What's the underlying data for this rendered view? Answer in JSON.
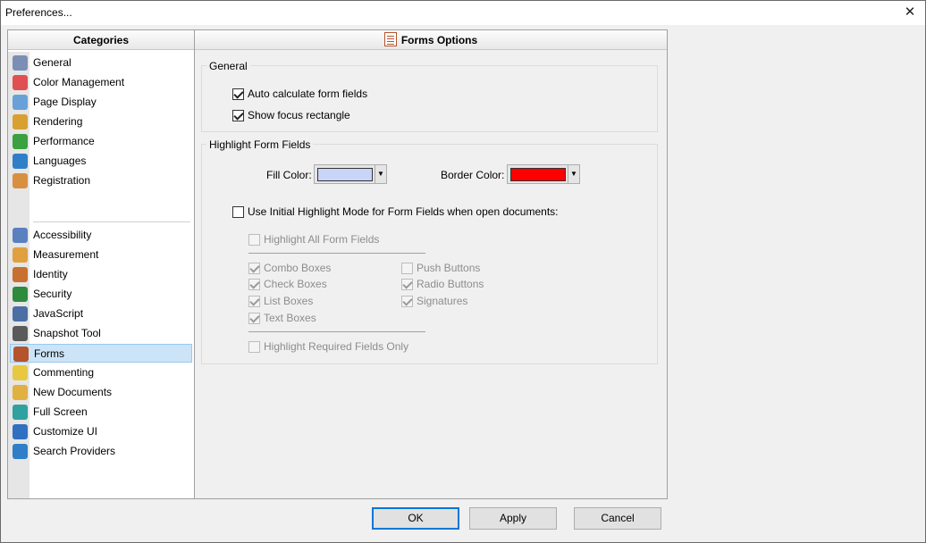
{
  "window": {
    "title": "Preferences...",
    "close_glyph": "✕"
  },
  "categories": {
    "header": "Categories",
    "group1": [
      {
        "label": "General",
        "icon": "gears-icon",
        "color": "#7b8fb5"
      },
      {
        "label": "Color Management",
        "icon": "color-circles-icon",
        "color": "#e05050"
      },
      {
        "label": "Page Display",
        "icon": "magnifier-page-icon",
        "color": "#6aa0d8"
      },
      {
        "label": "Rendering",
        "icon": "brush-icon",
        "color": "#d8a030"
      },
      {
        "label": "Performance",
        "icon": "chart-icon",
        "color": "#3aa040"
      },
      {
        "label": "Languages",
        "icon": "globe-icon",
        "color": "#2f7fc8"
      },
      {
        "label": "Registration",
        "icon": "user-icon",
        "color": "#d89040"
      }
    ],
    "group2": [
      {
        "label": "Accessibility",
        "icon": "accessibility-icon",
        "color": "#5a80c0"
      },
      {
        "label": "Measurement",
        "icon": "ruler-icon",
        "color": "#e0a040"
      },
      {
        "label": "Identity",
        "icon": "identity-icon",
        "color": "#c87030"
      },
      {
        "label": "Security",
        "icon": "shield-icon",
        "color": "#2e8b3e"
      },
      {
        "label": "JavaScript",
        "icon": "javascript-icon",
        "color": "#4a6fa5"
      },
      {
        "label": "Snapshot Tool",
        "icon": "camera-icon",
        "color": "#5a5a5a"
      },
      {
        "label": "Forms",
        "icon": "form-icon",
        "color": "#b5532c",
        "selected": true
      },
      {
        "label": "Commenting",
        "icon": "comment-icon",
        "color": "#e8c840"
      },
      {
        "label": "New Documents",
        "icon": "new-document-icon",
        "color": "#e0b040"
      },
      {
        "label": "Full Screen",
        "icon": "fullscreen-icon",
        "color": "#30a0a0"
      },
      {
        "label": "Customize UI",
        "icon": "customize-icon",
        "color": "#3070c0"
      },
      {
        "label": "Search Providers",
        "icon": "search-globe-icon",
        "color": "#2f7fc8"
      }
    ]
  },
  "options": {
    "header": "Forms Options",
    "general": {
      "title": "General",
      "auto_calc": {
        "label": "Auto calculate form fields",
        "checked": true
      },
      "focus_rect": {
        "label": "Show focus rectangle",
        "checked": true
      }
    },
    "highlight": {
      "title": "Highlight Form Fields",
      "fill_label": "Fill Color:",
      "fill_color": "#c8d4f8",
      "border_label": "Border Color:",
      "border_color": "#ff0000",
      "arrow_glyph": "▼",
      "use_initial": {
        "label": "Use Initial Highlight Mode for Form Fields when open documents:",
        "checked": false
      },
      "highlight_all": {
        "label": "Highlight All Form Fields",
        "checked": false
      },
      "combo": {
        "label": "Combo Boxes",
        "checked": true
      },
      "check": {
        "label": "Check Boxes",
        "checked": true
      },
      "list": {
        "label": "List Boxes",
        "checked": true
      },
      "text": {
        "label": "Text Boxes",
        "checked": true
      },
      "push": {
        "label": "Push Buttons",
        "checked": false
      },
      "radio": {
        "label": "Radio Buttons",
        "checked": true
      },
      "sig": {
        "label": "Signatures",
        "checked": true
      },
      "required_only": {
        "label": "Highlight Required Fields Only",
        "checked": false
      }
    }
  },
  "buttons": {
    "ok": "OK",
    "apply": "Apply",
    "cancel": "Cancel"
  }
}
